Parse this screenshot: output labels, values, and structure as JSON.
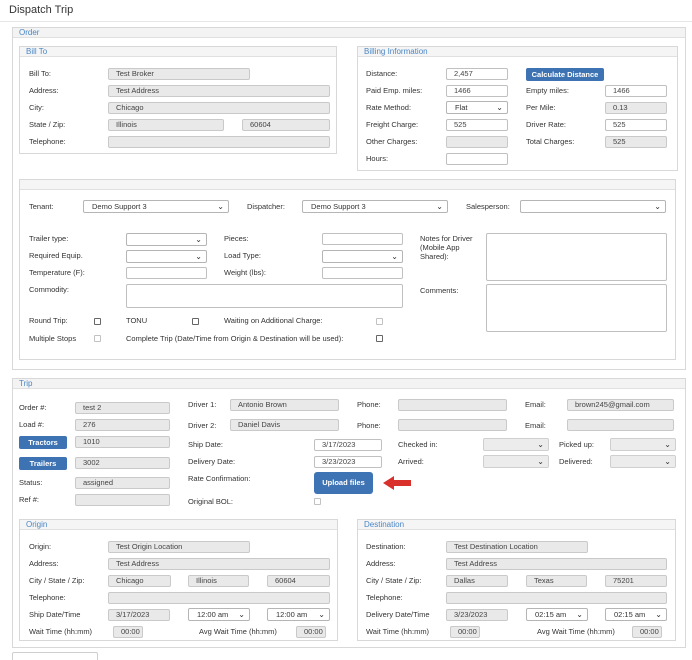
{
  "page": {
    "title": "Dispatch Trip"
  },
  "order": {
    "header": "Order",
    "bill_to": {
      "header": "Bill To",
      "bill_to_label": "Bill To:",
      "bill_to": "Test Broker",
      "address_label": "Address:",
      "address": "Test Address",
      "city_label": "City:",
      "city": "Chicago",
      "state_zip_label": "State / Zip:",
      "state": "Illinois",
      "zip": "60604",
      "telephone_label": "Telephone:",
      "telephone": ""
    },
    "billing": {
      "header": "Billing Information",
      "distance_label": "Distance:",
      "distance": "2,457",
      "calc_button": "Calculate Distance",
      "paid_emp_miles_label": "Paid Emp. miles:",
      "paid_emp_miles": "1466",
      "empty_miles_label": "Empty miles:",
      "empty_miles": "1466",
      "rate_method_label": "Rate Method:",
      "rate_method": "Flat",
      "per_mile_label": "Per Mile:",
      "per_mile": "0.13",
      "freight_charge_label": "Freight Charge:",
      "freight_charge": "525",
      "driver_rate_label": "Driver Rate:",
      "driver_rate": "525",
      "other_charges_label": "Other Charges:",
      "other_charges": "",
      "total_charges_label": "Total Charges:",
      "total_charges": "525",
      "hours_label": "Hours:",
      "hours": ""
    },
    "details": {
      "tenant_label": "Tenant:",
      "tenant": "Demo Support 3",
      "dispatcher_label": "Dispatcher:",
      "dispatcher": "Demo Support 3",
      "salesperson_label": "Salesperson:",
      "salesperson": "",
      "trailer_type_label": "Trailer type:",
      "pieces_label": "Pieces:",
      "notes_label": "Notes for Driver (Mobile App Shared):",
      "required_equip_label": "Required Equip.",
      "load_type_label": "Load Type:",
      "temperature_label": "Temperature (F):",
      "weight_label": "Weight (lbs):",
      "commodity_label": "Commodity:",
      "comments_label": "Comments:",
      "round_trip_label": "Round Trip:",
      "tonu_label": "TONU",
      "waiting_label": "Waiting on Additional Charge:",
      "multiple_stops_label": "Multiple Stops",
      "complete_trip_label": "Complete Trip (Date/Time from Origin & Destination will be used):"
    }
  },
  "trip": {
    "header": "Trip",
    "order_no_label": "Order #:",
    "order_no": "test 2",
    "load_no_label": "Load #:",
    "load_no": "276",
    "tractors_button": "Tractors",
    "tractor": "1010",
    "trailers_button": "Trailers",
    "trailer": "3002",
    "status_label": "Status:",
    "status": "assigned",
    "ref_label": "Ref #:",
    "ref": "",
    "driver1_label": "Driver 1:",
    "driver1": "Antonio Brown",
    "driver2_label": "Driver 2:",
    "driver2": "Daniel Davis",
    "ship_date_label": "Ship Date:",
    "ship_date": "3/17/2023",
    "delivery_date_label": "Delivery Date:",
    "delivery_date": "3/23/2023",
    "rate_conf_label": "Rate Confirmation:",
    "upload_button": "Upload files",
    "original_bol_label": "Original BOL:",
    "phone_label": "Phone:",
    "phone1": "",
    "phone2": "",
    "email_label": "Email:",
    "email1": "brown245@gmail.com",
    "email2": "",
    "checked_in_label": "Checked in:",
    "picked_up_label": "Picked up:",
    "arrived_label": "Arrived:",
    "delivered_label": "Delivered:",
    "arrow_color": "#d9302c"
  },
  "origin": {
    "header": "Origin",
    "origin_label": "Origin:",
    "origin": "Test Origin Location",
    "address_label": "Address:",
    "address": "Test Address",
    "csz_label": "City / State / Zip:",
    "city": "Chicago",
    "state": "Illinois",
    "zip": "60604",
    "telephone_label": "Telephone:",
    "telephone": "",
    "ship_dt_label": "Ship Date/Time",
    "date": "3/17/2023",
    "time1": "12:00 am",
    "time2": "12:00 am",
    "wait_label": "Wait Time (hh:mm)",
    "wait": "00:00",
    "avg_wait_label": "Avg Wait Time (hh:mm)",
    "avg_wait": "00:00"
  },
  "destination": {
    "header": "Destination",
    "destination_label": "Destination:",
    "destination": "Test Destination Location",
    "address_label": "Address:",
    "address": "Test Address",
    "csz_label": "City / State / Zip:",
    "city": "Dallas",
    "state": "Texas",
    "zip": "75201",
    "telephone_label": "Telephone:",
    "telephone": "",
    "delivery_dt_label": "Delivery Date/Time",
    "date": "3/23/2023",
    "time1": "02:15 am",
    "time2": "02:15 am",
    "wait_label": "Wait Time (hh:mm)",
    "wait": "00:00",
    "avg_wait_label": "Avg Wait Time (hh:mm)",
    "avg_wait": "00:00"
  }
}
